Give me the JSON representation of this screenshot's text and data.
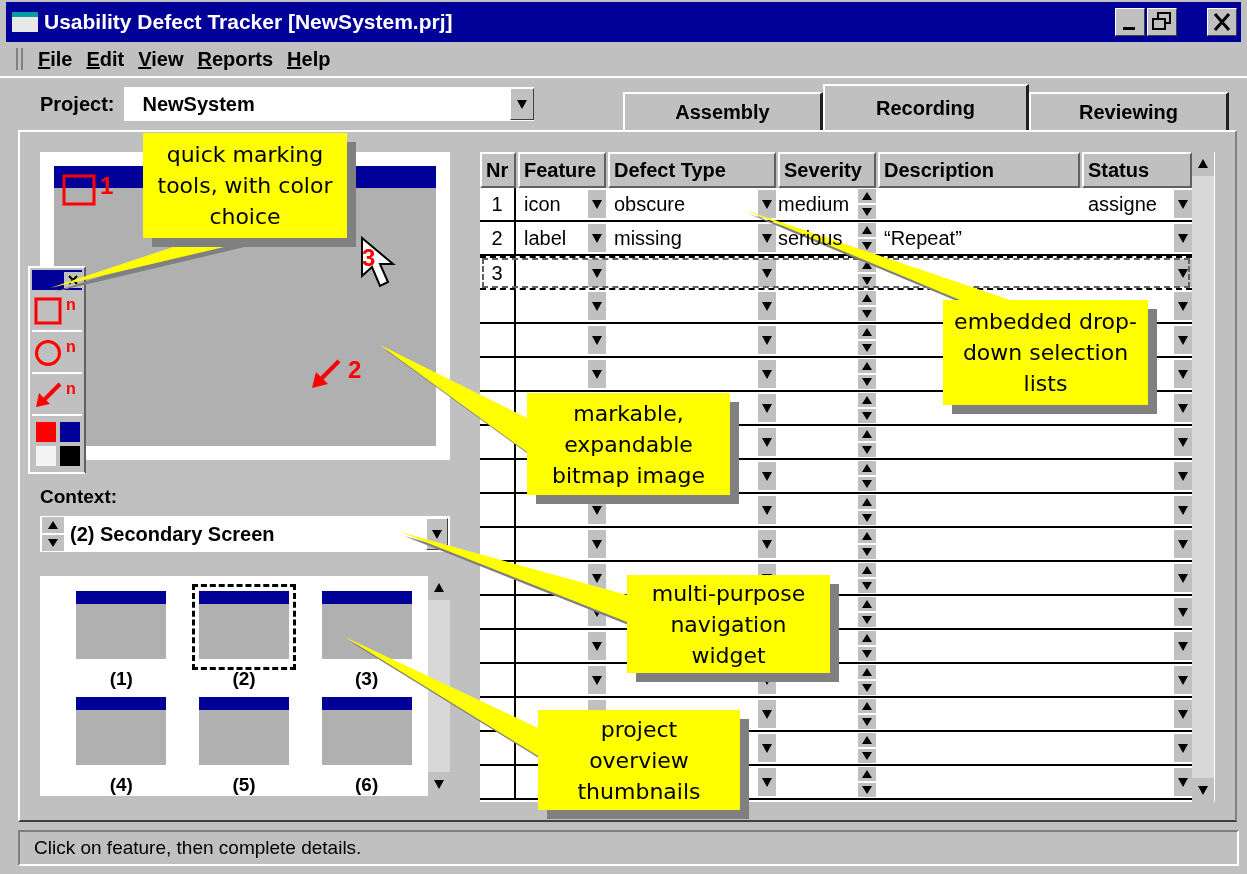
{
  "window": {
    "title": "Usability Defect Tracker [NewSystem.prj]"
  },
  "menu": [
    {
      "label": "File"
    },
    {
      "label": "Edit"
    },
    {
      "label": "View"
    },
    {
      "label": "Reports"
    },
    {
      "label": "Help"
    }
  ],
  "project": {
    "label": "Project:",
    "value": "NewSystem"
  },
  "tabs": [
    {
      "label": "Assembly",
      "selected": false
    },
    {
      "label": "Recording",
      "selected": true
    },
    {
      "label": "Reviewing",
      "selected": false
    }
  ],
  "image_marks": [
    {
      "kind": "rect",
      "label": "1"
    },
    {
      "kind": "arrow",
      "label": "2"
    },
    {
      "kind": "cursor",
      "label": "3"
    }
  ],
  "tool_palette": {
    "tools": [
      {
        "kind": "rect",
        "label": "n"
      },
      {
        "kind": "circle",
        "label": "n"
      },
      {
        "kind": "arrow",
        "label": "n"
      }
    ],
    "colors": [
      {
        "color": "#ff0000"
      },
      {
        "color": "#000099"
      },
      {
        "color": "#f4f4f4"
      },
      {
        "color": "#000000"
      }
    ]
  },
  "context": {
    "label": "Context:",
    "value": "(2) Secondary Screen"
  },
  "thumbnails": [
    {
      "label": "(1)",
      "selected": false
    },
    {
      "label": "(2)",
      "selected": true
    },
    {
      "label": "(3)",
      "selected": false
    },
    {
      "label": "(4)",
      "selected": false
    },
    {
      "label": "(5)",
      "selected": false
    },
    {
      "label": "(6)",
      "selected": false
    }
  ],
  "table": {
    "columns": [
      {
        "label": "Nr"
      },
      {
        "label": "Feature"
      },
      {
        "label": "Defect Type"
      },
      {
        "label": "Severity"
      },
      {
        "label": "Description"
      },
      {
        "label": "Status"
      }
    ],
    "rows": [
      {
        "nr": "1",
        "feature": "icon",
        "defect_type": "obscure",
        "severity": "medium",
        "status": "assigne",
        "selected": false
      },
      {
        "nr": "2",
        "feature": "label",
        "defect_type": "missing",
        "severity": "serious",
        "description": "“Repeat”",
        "selected": false
      },
      {
        "nr": "3",
        "selected": true
      }
    ]
  },
  "callouts": [
    {
      "text": "quick marking tools, with color choice"
    },
    {
      "text": "markable, expandable bitmap image"
    },
    {
      "text": "embedded drop-down selection lists"
    },
    {
      "text": "multi-purpose navigation widget"
    },
    {
      "text": "project overview thumbnails"
    }
  ],
  "status_bar": "Click on feature, then complete details."
}
